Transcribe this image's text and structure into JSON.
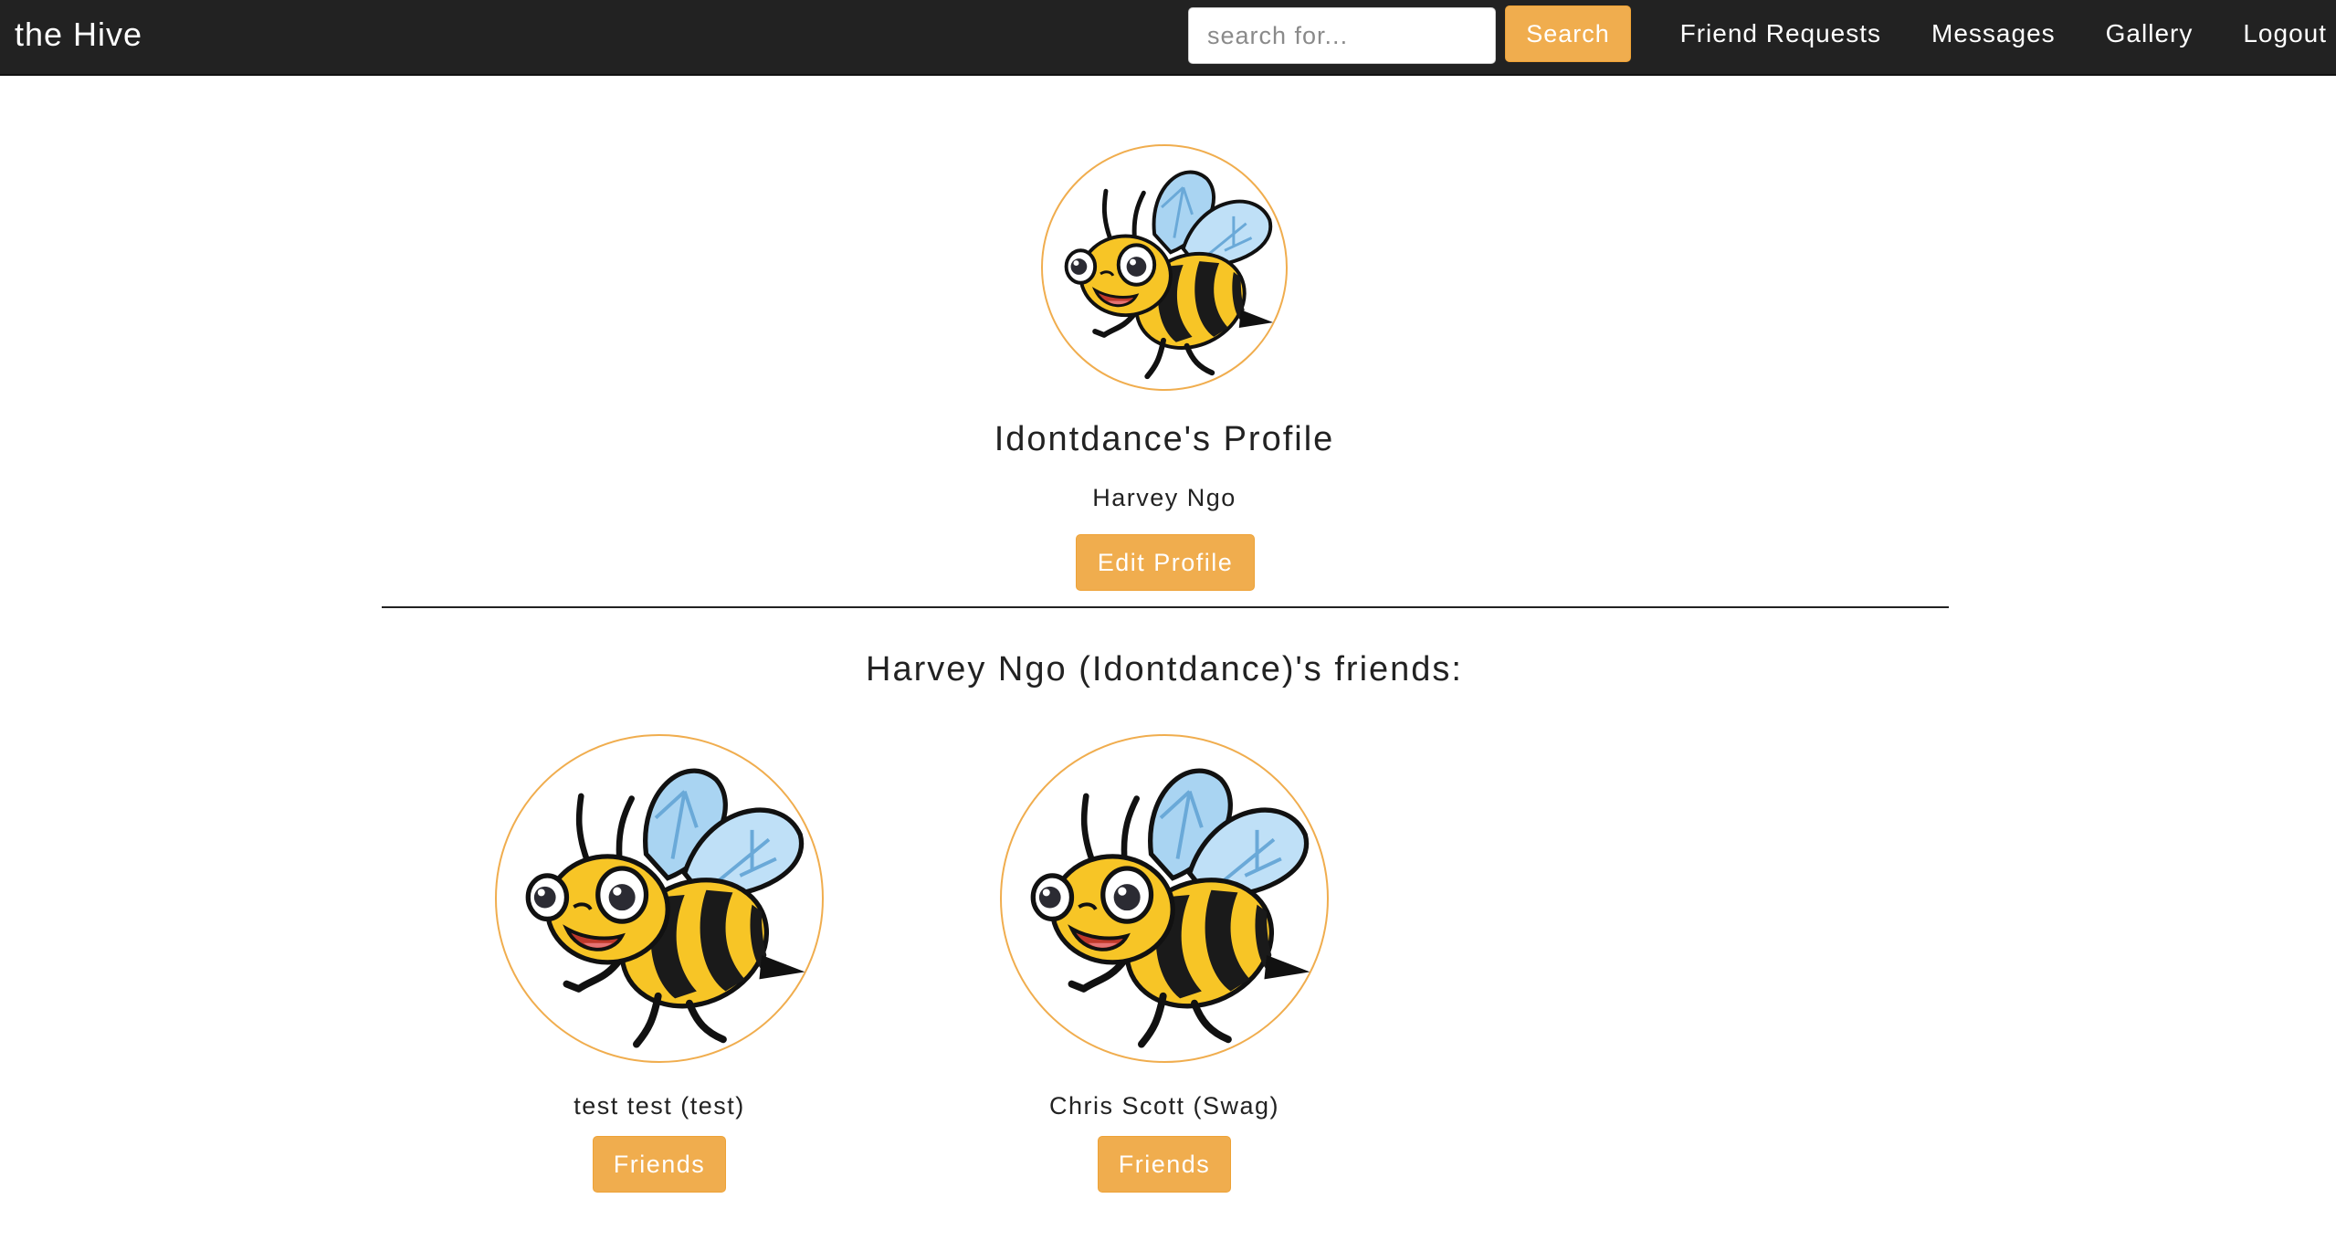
{
  "navbar": {
    "brand": "the Hive",
    "search_placeholder": "search for...",
    "search_button": "Search",
    "links": [
      "Friend Requests",
      "Messages",
      "Gallery",
      "Logout"
    ]
  },
  "profile": {
    "title": "Idontdance's Profile",
    "real_name": "Harvey Ngo",
    "edit_button": "Edit Profile",
    "avatar_icon": "bee-icon"
  },
  "friends": {
    "heading": "Harvey Ngo (Idontdance)'s friends:",
    "items": [
      {
        "name": "test test (test)",
        "button": "Friends",
        "avatar_icon": "bee-icon"
      },
      {
        "name": "Chris Scott (Swag)",
        "button": "Friends",
        "avatar_icon": "bee-icon"
      }
    ]
  },
  "colors": {
    "navbar_bg": "#222222",
    "accent": "#f0ad4e",
    "text": "#222222"
  }
}
